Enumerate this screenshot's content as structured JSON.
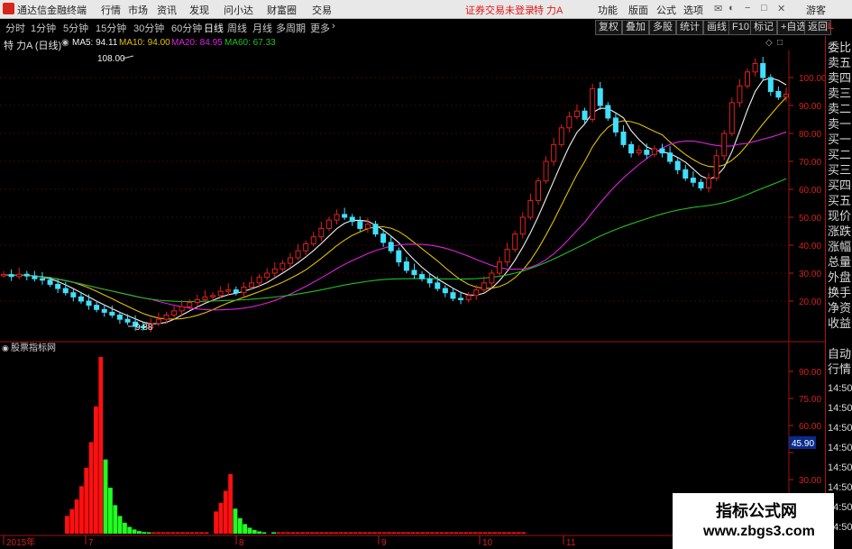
{
  "titlebar": {
    "app_name": "通达信金融终端",
    "menu": [
      "行情",
      "市场",
      "资讯",
      "发现",
      "问小达",
      "财富圈",
      "交易"
    ],
    "login_status": "证券交易未登录",
    "stock_name": "特 力A",
    "right_menu": [
      "功能",
      "版面",
      "公式",
      "选项"
    ],
    "account_label": "游客"
  },
  "toolbar": {
    "periods": [
      "分时",
      "1分钟",
      "5分钟",
      "15分钟",
      "30分钟",
      "60分钟",
      "日线",
      "周线",
      "月线",
      "多周期",
      "更多"
    ],
    "active_period": "日线",
    "buttons": [
      "复权",
      "叠加",
      "多股",
      "统计",
      "画线",
      "F10",
      "标记",
      "+自选",
      "返回"
    ]
  },
  "infobar": {
    "title": "特 力A (日线)",
    "ma5": "MA5: 94.11",
    "ma10": "MA10: 94.00",
    "ma20": "MA20: 84.95",
    "ma60": "MA60: 67.33"
  },
  "price_axis": [
    "100.00",
    "90.00",
    "80.00",
    "70.00",
    "60.00",
    "50.00",
    "40.00",
    "30.00",
    "20.00"
  ],
  "annotations": {
    "high": "108.00",
    "low": "9.88"
  },
  "indicator": {
    "title": "股票指标网",
    "axis": [
      "90.00",
      "75.00",
      "60.00",
      "45.90",
      "30.00"
    ],
    "current": "45.90"
  },
  "date_axis": [
    "2015年",
    "7",
    "8",
    "9",
    "10",
    "11"
  ],
  "right_panel": {
    "top_label": "L",
    "labels": [
      "委比",
      "卖五",
      "卖四",
      "卖三",
      "卖二",
      "卖一",
      "买一",
      "买二",
      "买三",
      "买四",
      "买五",
      "现价",
      "涨跌",
      "涨幅",
      "总量",
      "外盘",
      "换手",
      "净资",
      "收益"
    ],
    "bottom_labels": [
      "自动",
      "行情"
    ],
    "times": [
      "14:50",
      "14:50",
      "14:50",
      "14:50",
      "14:50",
      "14:50",
      "14:50",
      "14:50"
    ]
  },
  "watermark": {
    "line1": "指标公式网",
    "line2": "www.zbgs3.com"
  },
  "colors": {
    "up": "#e02020",
    "down": "#40e0ff",
    "ma5": "#f0f0f0",
    "ma10": "#e0c000",
    "ma20": "#e020e0",
    "ma60": "#20c020",
    "vol_up": "#ff1010",
    "vol_down": "#20ff20"
  },
  "chart_data": {
    "type": "candlestick",
    "closes": [
      29.5,
      28.8,
      29.6,
      29.0,
      28.0,
      27.5,
      26.0,
      24.5,
      23.0,
      21.5,
      20.0,
      18.5,
      17.0,
      16.0,
      15.0,
      13.5,
      12.5,
      11.0,
      10.5,
      12.0,
      13.5,
      15.0,
      16.5,
      18.0,
      19.5,
      20.5,
      21.5,
      22.0,
      23.5,
      24.0,
      23.0,
      25.0,
      26.5,
      28.5,
      30.0,
      31.5,
      33.5,
      35.5,
      38.0,
      40.5,
      43.0,
      46.0,
      49.0,
      51.0,
      50.0,
      48.5,
      46.0,
      47.5,
      44.0,
      41.0,
      38.0,
      34.0,
      31.0,
      29.5,
      28.0,
      26.5,
      24.5,
      23.0,
      21.0,
      20.5,
      22.0,
      24.0,
      26.5,
      30.0,
      34.0,
      38.5,
      44.0,
      50.0,
      56.0,
      63.0,
      70.0,
      76.0,
      82.0,
      86.0,
      88.0,
      85.0,
      96.0,
      90.0,
      85.5,
      80.5,
      76.0,
      73.0,
      74.0,
      72.5,
      74.5,
      73.0,
      70.0,
      67.0,
      64.0,
      62.5,
      60.5,
      64.0,
      72.0,
      80.0,
      91.0,
      97.0,
      102.0,
      105.0,
      100.0,
      95.0,
      93.0,
      94.0
    ]
  }
}
